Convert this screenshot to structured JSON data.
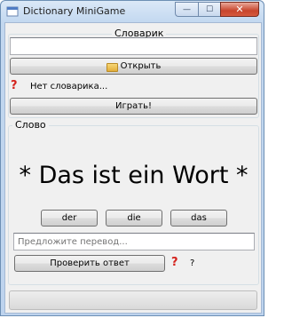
{
  "window": {
    "title": "Dictionary MiniGame",
    "controls": {
      "minimize": "—",
      "maximize": "☐",
      "close": "✕"
    }
  },
  "dictionary": {
    "group_title": "Словарик",
    "path_value": "",
    "open_button": "Открыть",
    "status_icon": "question-icon",
    "status_text": "Нет словарика...",
    "play_button": "Играть!"
  },
  "game": {
    "group_title": "Слово",
    "word": "* Das ist ein Wort *",
    "articles": [
      "der",
      "die",
      "das"
    ],
    "translation_placeholder": "Предложите перевод...",
    "check_button": "Проверить ответ",
    "result_icon": "question-icon",
    "result_mark": "?"
  },
  "progress": {
    "value": 0
  },
  "colors": {
    "question_icon": "#d4221c",
    "close_button": "#c8452d"
  }
}
